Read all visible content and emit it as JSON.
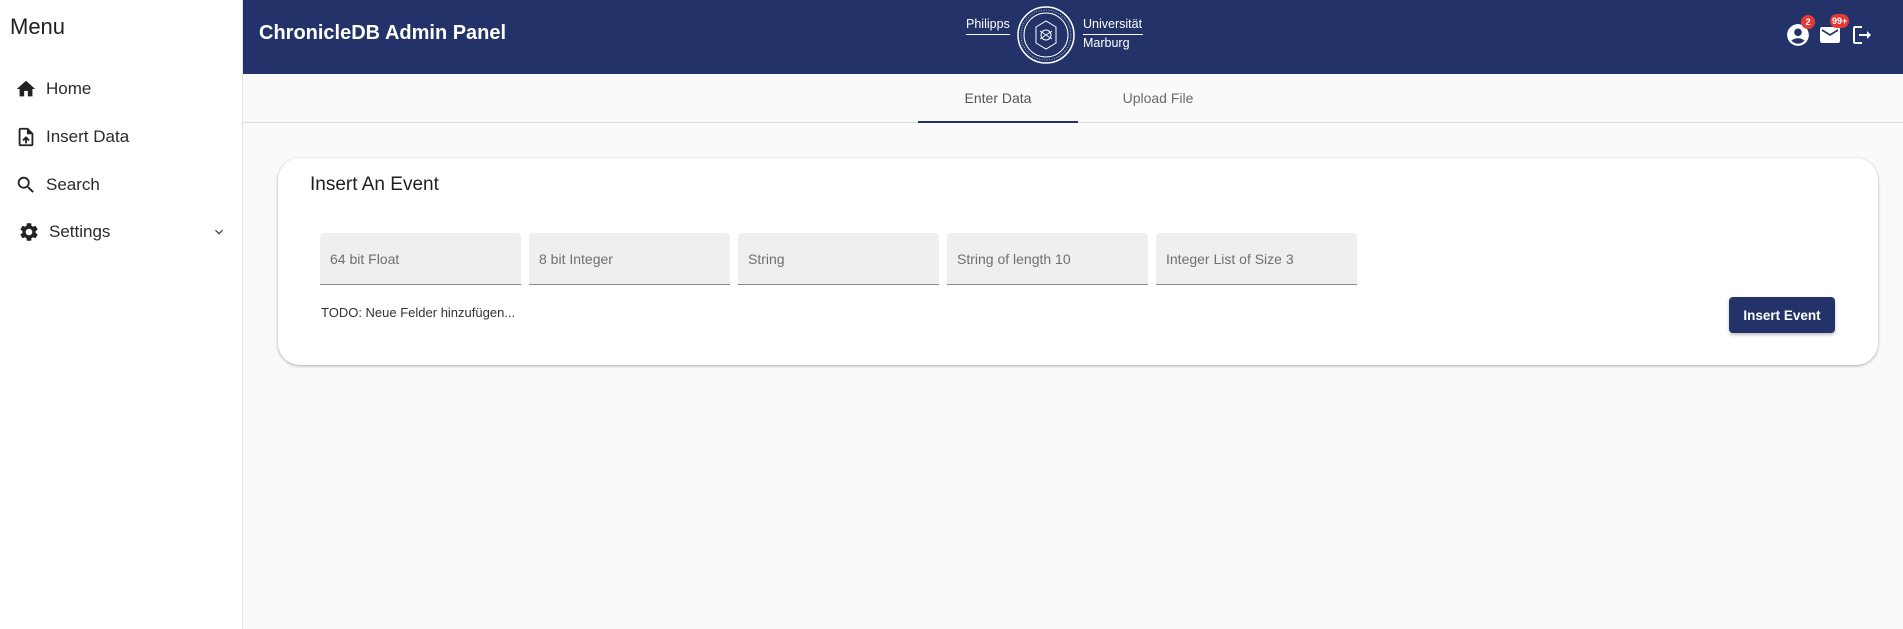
{
  "sidebar": {
    "title": "Menu",
    "items": [
      {
        "label": "Home",
        "icon": "home-icon"
      },
      {
        "label": "Insert Data",
        "icon": "file-upload-icon"
      },
      {
        "label": "Search",
        "icon": "search-icon"
      },
      {
        "label": "Settings",
        "icon": "gear-icon"
      }
    ]
  },
  "header": {
    "title": "ChronicleDB Admin Panel",
    "logo": {
      "left_text": "Philipps",
      "right_text_1": "Universität",
      "right_text_2": "Marburg"
    },
    "account_badge": "2",
    "mail_badge": "99+",
    "color": "#233369"
  },
  "tabs": [
    {
      "label": "Enter Data",
      "active": true
    },
    {
      "label": "Upload File",
      "active": false
    }
  ],
  "card": {
    "title": "Insert An Event",
    "fields": [
      {
        "placeholder": "64 bit Float",
        "value": ""
      },
      {
        "placeholder": "8 bit Integer",
        "value": ""
      },
      {
        "placeholder": "String",
        "value": ""
      },
      {
        "placeholder": "String of length 10",
        "value": ""
      },
      {
        "placeholder": "Integer List of Size 3",
        "value": ""
      }
    ],
    "todo_text": "TODO: Neue Felder hinzufügen...",
    "button_label": "Insert Event"
  },
  "colors": {
    "primary": "#233369",
    "badge": "#e53935"
  }
}
